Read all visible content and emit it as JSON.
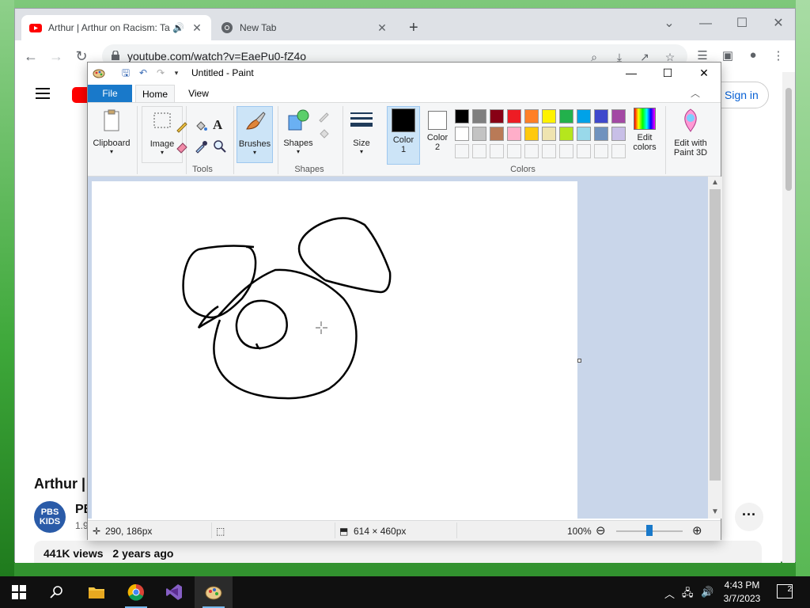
{
  "browser": {
    "tabs": [
      {
        "title": "Arthur | Arthur on Racism: Ta",
        "favicon": "youtube-icon",
        "audio": true
      },
      {
        "title": "New Tab",
        "favicon": "chrome-icon"
      }
    ],
    "url": "youtube.com/watch?v=EaePu0-fZ4o"
  },
  "youtube": {
    "signin_label": "Sign in",
    "video_title": "Arthur |",
    "channel_logo_text": "PBS KIDS",
    "channel_name": "PB",
    "subscribers": "1.9",
    "views": "441K views",
    "published": "2 years ago"
  },
  "paint": {
    "window_title": "Untitled - Paint",
    "tabs": {
      "file": "File",
      "home": "Home",
      "view": "View"
    },
    "ribbon": {
      "clipboard": "Clipboard",
      "image": "Image",
      "tools_group": "Tools",
      "brushes": "Brushes",
      "shapes": "Shapes",
      "shapes_group": "Shapes",
      "size": "Size",
      "color1": "Color\n1",
      "color2": "Color\n2",
      "edit_colors": "Edit\ncolors",
      "colors_group": "Colors",
      "paint3d": "Edit with\nPaint 3D"
    },
    "palette_row1": [
      "#000000",
      "#7f7f7f",
      "#880015",
      "#ed1c24",
      "#ff7f27",
      "#fff200",
      "#22b14c",
      "#00a2e8",
      "#3f48cc",
      "#a349a4"
    ],
    "palette_row2": [
      "#ffffff",
      "#c3c3c3",
      "#b97a57",
      "#ffaec9",
      "#ffc90e",
      "#efe4b0",
      "#b5e61d",
      "#99d9ea",
      "#7092be",
      "#c8bfe7"
    ],
    "status": {
      "cursor_pos": "290, 186px",
      "canvas_size": "614 × 460px",
      "zoom": "100%"
    }
  },
  "taskbar": {
    "time": "4:43 PM",
    "date": "3/7/2023",
    "notifications": "2"
  }
}
